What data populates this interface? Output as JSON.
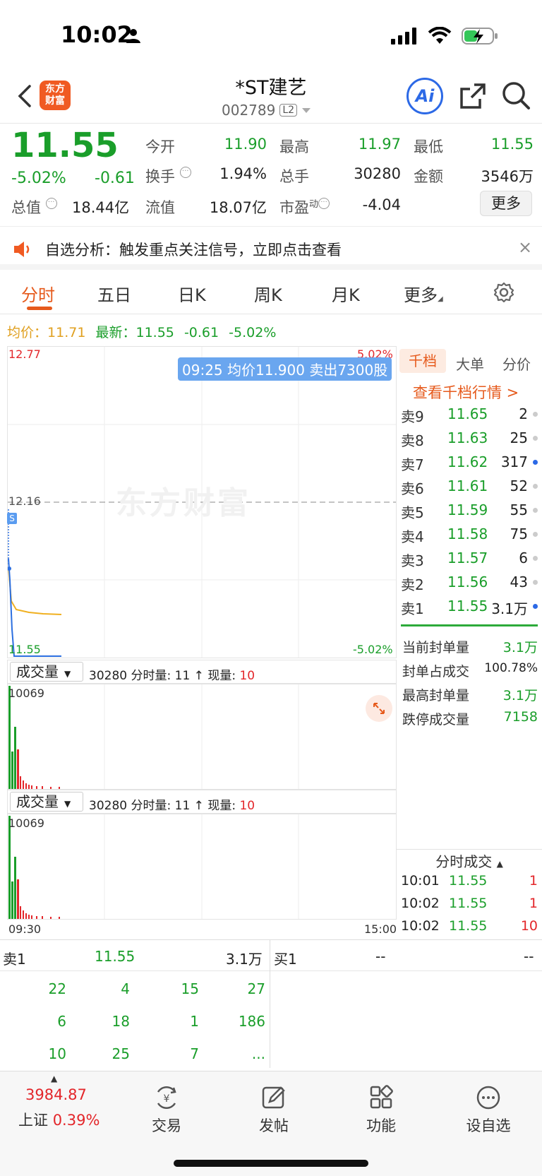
{
  "status": {
    "time": "10:02"
  },
  "header": {
    "logo_line1": "东方",
    "logo_line2": "财富",
    "stock_name": "*ST建艺",
    "stock_code": "002789",
    "level_badge": "L2",
    "ai_label": "Ai"
  },
  "quote": {
    "price": "11.55",
    "pct_change": "-5.02%",
    "abs_change": "-0.61",
    "total_value_label": "总值",
    "total_value": "18.44亿",
    "fields": [
      {
        "label": "今开",
        "value": "11.90"
      },
      {
        "label": "最高",
        "value": "11.97"
      },
      {
        "label": "最低",
        "value": "11.55"
      },
      {
        "label": "换手",
        "value": "1.94%"
      },
      {
        "label": "总手",
        "value": "30280"
      },
      {
        "label": "金额",
        "value": "3546万"
      },
      {
        "label": "流值",
        "value": "18.07亿"
      },
      {
        "label": "市盈",
        "value": "-4.04"
      }
    ],
    "pe_superscript": "动",
    "more_label": "更多"
  },
  "banner": {
    "text": "自选分析：触发重点关注信号，立即点击查看",
    "close": "×"
  },
  "tabs": [
    "分时",
    "五日",
    "日K",
    "周K",
    "月K",
    "更多"
  ],
  "avg_line": {
    "avg_label": "均价：",
    "avg_value": "11.71",
    "latest_label": "最新：",
    "latest_value": "11.55",
    "change": "-0.61",
    "pct": "-5.02%"
  },
  "chart": {
    "top_price": "12.77",
    "top_pct": "5.02%",
    "mid_price": "12.16",
    "bottom_price": "11.55",
    "bottom_pct": "-5.02%",
    "tooltip": "09:25 均价11.900 卖出7300股",
    "watermark": "东方财富",
    "marker": "S",
    "time_start": "09:30",
    "time_end": "15:00"
  },
  "volume_panels": [
    {
      "select": "成交量",
      "total": "30280",
      "fen_label": "分时量: 11 ↑",
      "now_label": "现量:",
      "now_value": "10",
      "max": "10069"
    },
    {
      "select": "成交量",
      "total": "30280",
      "fen_label": "分时量: 11 ↑",
      "now_label": "现量:",
      "now_value": "10",
      "max": "10069"
    }
  ],
  "order_book": {
    "tabs": [
      "千档",
      "大单",
      "分价"
    ],
    "view_link": "查看千档行情 >",
    "asks": [
      {
        "label": "卖9",
        "price": "11.65",
        "qty": "2",
        "dot": "#cccccc"
      },
      {
        "label": "卖8",
        "price": "11.63",
        "qty": "25",
        "dot": "#cccccc"
      },
      {
        "label": "卖7",
        "price": "11.62",
        "qty": "317",
        "dot": "#2c69e6"
      },
      {
        "label": "卖6",
        "price": "11.61",
        "qty": "52",
        "dot": "#cccccc"
      },
      {
        "label": "卖5",
        "price": "11.59",
        "qty": "55",
        "dot": "#cccccc"
      },
      {
        "label": "卖4",
        "price": "11.58",
        "qty": "75",
        "dot": "#cccccc"
      },
      {
        "label": "卖3",
        "price": "11.57",
        "qty": "6",
        "dot": "#cccccc"
      },
      {
        "label": "卖2",
        "price": "11.56",
        "qty": "43",
        "dot": "#cccccc"
      },
      {
        "label": "卖1",
        "price": "11.55",
        "qty": "3.1万",
        "dot": "#2c69e6"
      }
    ],
    "seal": [
      {
        "label": "当前封单量",
        "value": "3.1万"
      },
      {
        "label": "封单占成交",
        "value": "100.78%"
      },
      {
        "label": "最高封单量",
        "value": "3.1万"
      },
      {
        "label": "跌停成交量",
        "value": "7158"
      }
    ],
    "ticks_header": "分时成交",
    "ticks": [
      {
        "time": "10:01",
        "price": "11.55",
        "vol": "1"
      },
      {
        "time": "10:02",
        "price": "11.55",
        "vol": "1"
      },
      {
        "time": "10:02",
        "price": "11.55",
        "vol": "10"
      }
    ]
  },
  "order_strip": {
    "sell_label": "卖1",
    "sell_price": "11.55",
    "sell_qty": "3.1万",
    "buy_label": "买1",
    "buy_price": "--",
    "buy_qty": "--",
    "queue": [
      [
        "22",
        "4",
        "15",
        "27"
      ],
      [
        "6",
        "18",
        "1",
        "186"
      ],
      [
        "10",
        "25",
        "7",
        "..."
      ]
    ]
  },
  "bottom_nav": {
    "index_value": "3984.87",
    "index_name": "上证",
    "index_pct": "0.39%",
    "items": [
      "交易",
      "发帖",
      "功能",
      "设自选"
    ]
  }
}
